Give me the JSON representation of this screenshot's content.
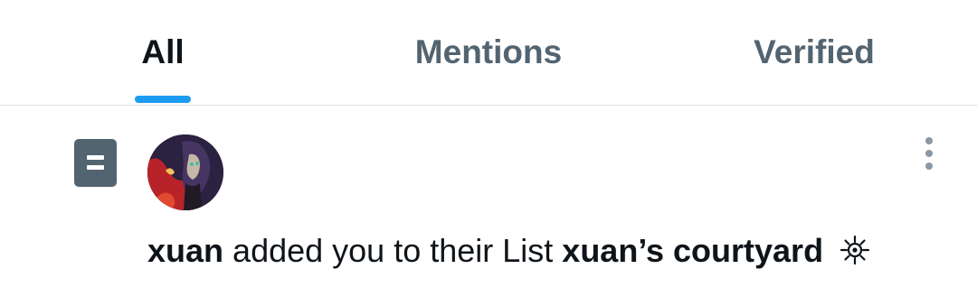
{
  "tabs": [
    {
      "label": "All",
      "active": true
    },
    {
      "label": "Mentions",
      "active": false
    },
    {
      "label": "Verified",
      "active": false
    }
  ],
  "notification": {
    "type_icon": "list-icon",
    "avatar": "user-avatar",
    "user": "xuan",
    "action": "added you to their List",
    "list_name": "xuan’s courtyard",
    "emoji_icon": "sun-ornament-icon",
    "menu_icon": "more-options-icon"
  },
  "colors": {
    "accent": "#1d9bf0",
    "text_primary": "#0f1419",
    "text_secondary": "#536471",
    "divider": "#d9dee2"
  }
}
